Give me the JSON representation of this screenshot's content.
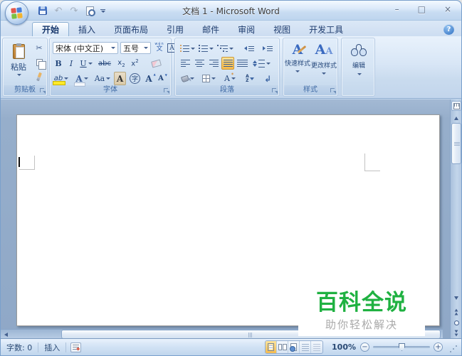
{
  "window": {
    "title": "文档 1 - Microsoft Word",
    "controls": {
      "minimize": "–",
      "maximize": "□",
      "close": "×"
    }
  },
  "qat": {
    "undo_glyph": "↶",
    "redo_glyph": "↷"
  },
  "tabs": {
    "help_glyph": "?",
    "items": [
      {
        "label": "开始",
        "active": true
      },
      {
        "label": "插入",
        "active": false
      },
      {
        "label": "页面布局",
        "active": false
      },
      {
        "label": "引用",
        "active": false
      },
      {
        "label": "邮件",
        "active": false
      },
      {
        "label": "审阅",
        "active": false
      },
      {
        "label": "视图",
        "active": false
      },
      {
        "label": "开发工具",
        "active": false
      }
    ]
  },
  "ribbon": {
    "clipboard": {
      "label": "剪贴板",
      "paste": "粘贴",
      "cut_glyph": "✂"
    },
    "font": {
      "label": "字体",
      "name_value": "宋体 (中文正)",
      "size_value": "五号",
      "bold": "B",
      "italic": "I",
      "underline": "U",
      "strike": "abc",
      "sub_base": "x",
      "sub_num": "2",
      "sup_base": "x",
      "sup_num": "2",
      "pinyin_top": "wén",
      "pinyin_char": "文",
      "char_border": "A",
      "highlight": "ab",
      "font_color": "A",
      "change_case": "Aa",
      "char_shading": "A",
      "enclose": "字",
      "grow": "A",
      "grow_mark": "▲",
      "shrink": "A",
      "shrink_mark": "▼"
    },
    "paragraph": {
      "label": "段落",
      "sort_a": "A",
      "sort_z": "Z",
      "asian": "A",
      "pilcrow": "↲"
    },
    "styles": {
      "label": "样式",
      "quick": "快速样式",
      "change": "更改样式",
      "quick_icon": "A",
      "change_icon_big": "A",
      "change_icon_small": "A"
    },
    "editing": {
      "label": "编辑"
    }
  },
  "document": {
    "watermark_title": "百科全说",
    "watermark_subtitle": "助你轻松解决"
  },
  "status": {
    "word_count": "字数: 0",
    "insert_mode": "插入",
    "zoom_value": "100%",
    "zoom_out": "−",
    "zoom_in": "+"
  },
  "colors": {
    "watermark_green": "#1fb141",
    "watermark_gray": "#a9a9a9",
    "selection_orange": "#f5bb4e"
  }
}
